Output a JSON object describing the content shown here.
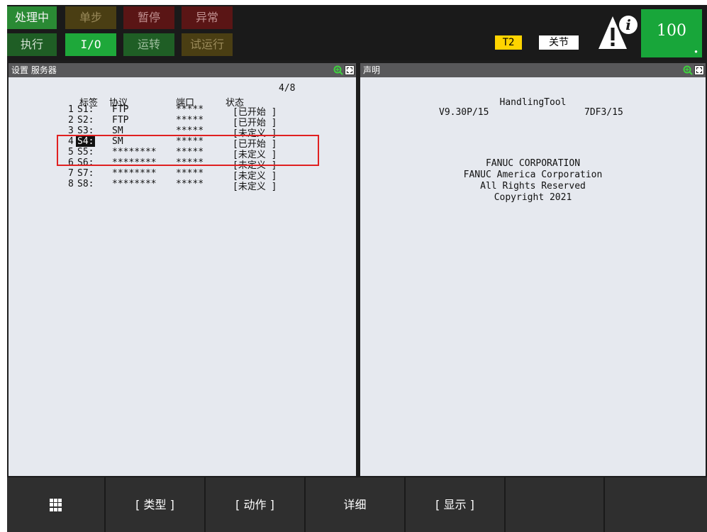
{
  "status_bar": {
    "row1": [
      {
        "label": "处理中",
        "bg": "#2a8a34",
        "fg": "#f2f2f2"
      },
      {
        "label": "单步",
        "bg": "#4a3e13",
        "fg": "#9a8a5a"
      },
      {
        "label": "暂停",
        "bg": "#5a1515",
        "fg": "#c09090"
      },
      {
        "label": "异常",
        "bg": "#5a1515",
        "fg": "#c09090"
      }
    ],
    "row2": [
      {
        "label": "执行",
        "bg": "#1f5e25",
        "fg": "#d0e0d0"
      },
      {
        "label": "I/O",
        "bg": "#1ea83a",
        "fg": "#ffffff"
      },
      {
        "label": "运转",
        "bg": "#1f5e25",
        "fg": "#9fbf9f"
      },
      {
        "label": "试运行",
        "bg": "#4a3e13",
        "fg": "#9a8a5a"
      }
    ],
    "mode_badge": "T2",
    "coord_badge": "关节",
    "alert_icon": "warning-info-icon",
    "override": "100"
  },
  "left_panel": {
    "title": "设置 服务器",
    "page_indicator": "4/8",
    "headers": {
      "label": "标签",
      "protocol": "协议",
      "port": "端口",
      "status": "状态"
    },
    "rows": [
      {
        "num": "1",
        "tag": "S1:",
        "protocol": "FTP",
        "port": "*****",
        "status": "[已开始   ]"
      },
      {
        "num": "2",
        "tag": "S2:",
        "protocol": "FTP",
        "port": "*****",
        "status": "[已开始   ]"
      },
      {
        "num": "3",
        "tag": "S3:",
        "protocol": "SM",
        "port": "*****",
        "status": "[未定义   ]"
      },
      {
        "num": "4",
        "tag": "S4:",
        "protocol": "SM",
        "port": "*****",
        "status": "[已开始   ]"
      },
      {
        "num": "5",
        "tag": "S5:",
        "protocol": "********",
        "port": "*****",
        "status": "[未定义   ]"
      },
      {
        "num": "6",
        "tag": "S6:",
        "protocol": "********",
        "port": "*****",
        "status": "[未定义   ]"
      },
      {
        "num": "7",
        "tag": "S7:",
        "protocol": "********",
        "port": "*****",
        "status": "[未定义   ]"
      },
      {
        "num": "8",
        "tag": "S8:",
        "protocol": "********",
        "port": "*****",
        "status": "[未定义   ]"
      }
    ],
    "selected_row": "4",
    "highlight_color": "#e02020"
  },
  "right_panel": {
    "title": "声明",
    "product": "HandlingTool",
    "version_left": "V9.30P/15",
    "version_right": "7DF3/15",
    "lines": [
      "FANUC CORPORATION",
      "FANUC America Corporation",
      "All Rights Reserved",
      "Copyright  2021"
    ]
  },
  "function_keys": {
    "menu_icon": "grid-menu-icon",
    "f1": "[ 类型 ]",
    "f2": "[ 动作 ]",
    "f3": "详细",
    "f4": "[ 显示 ]",
    "f5": "",
    "f6": ""
  }
}
